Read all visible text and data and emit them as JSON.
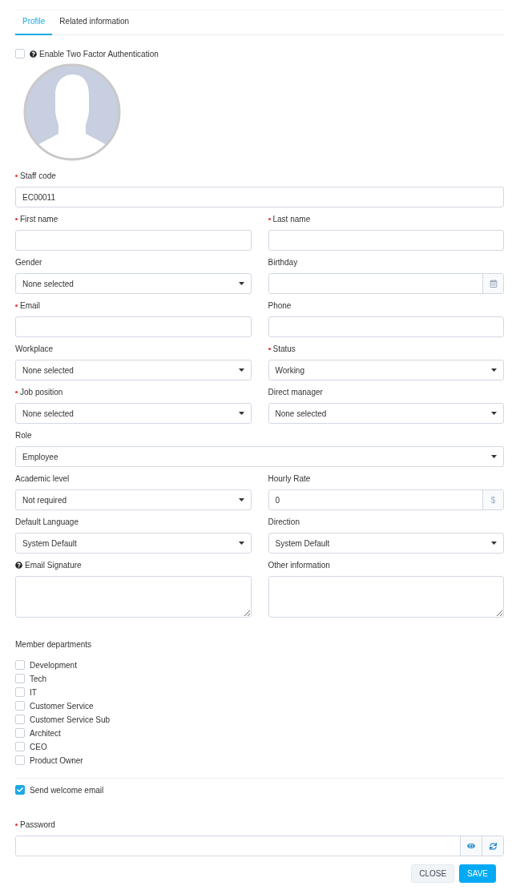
{
  "tabs": [
    {
      "label": "Profile",
      "selected": true
    },
    {
      "label": "Related information",
      "selected": false
    }
  ],
  "two_factor": {
    "label": "Enable Two Factor Authentication",
    "checked": false,
    "help": true
  },
  "avatar": {
    "kind": "picture"
  },
  "rows": [
    [
      {
        "label": "Staff code",
        "required": true,
        "kind": "text",
        "value": "EC00011"
      }
    ],
    [
      {
        "label": "First name",
        "required": true,
        "kind": "text"
      },
      {
        "label": "Last name",
        "required": true,
        "kind": "text"
      }
    ],
    [
      {
        "label": "Gender",
        "required": false,
        "kind": "select",
        "value": "None selected"
      },
      {
        "label": "Birthday",
        "required": false,
        "kind": "date"
      }
    ],
    [
      {
        "label": "Email",
        "required": true,
        "kind": "text"
      },
      {
        "label": "Phone",
        "required": false,
        "kind": "text"
      }
    ],
    [
      {
        "label": "Workplace",
        "required": false,
        "kind": "select",
        "value": "None selected"
      },
      {
        "label": "Status",
        "required": true,
        "kind": "select",
        "value": "Working"
      }
    ],
    [
      {
        "label": "Job position",
        "required": true,
        "kind": "select",
        "value": "None selected"
      },
      {
        "label": "Direct manager",
        "required": false,
        "kind": "select",
        "value": "None selected"
      }
    ],
    [
      {
        "label": "Role",
        "required": false,
        "kind": "select",
        "value": "Employee"
      }
    ],
    [
      {
        "label": "Academic level",
        "required": false,
        "kind": "select",
        "value": "Not required"
      },
      {
        "label": "Hourly Rate",
        "required": false,
        "kind": "addon",
        "value": "0",
        "addon": "$"
      }
    ],
    [
      {
        "label": "Default Language",
        "required": false,
        "kind": "select",
        "value": "System Default"
      },
      {
        "label": "Direction",
        "required": false,
        "kind": "select",
        "value": "System Default"
      }
    ],
    [
      {
        "label": "Email Signature",
        "required": false,
        "kind": "textarea",
        "help": true
      },
      {
        "label": "Other information",
        "required": false,
        "kind": "textarea"
      }
    ]
  ],
  "departments": {
    "title": "Member departments",
    "items": [
      {
        "label": "Development",
        "checked": false
      },
      {
        "label": "Tech",
        "checked": false
      },
      {
        "label": "IT",
        "checked": false
      },
      {
        "label": "Customer Service",
        "checked": false
      },
      {
        "label": "Customer Service Sub",
        "checked": false
      },
      {
        "label": "Architect",
        "checked": false
      },
      {
        "label": "CEO",
        "checked": false
      },
      {
        "label": "Product Owner",
        "checked": false
      }
    ]
  },
  "welcome_email": {
    "label": "Send welcome email",
    "checked": true
  },
  "password": {
    "label": "Password",
    "required": true
  },
  "buttons": [
    {
      "label": "CLOSE",
      "kind": "secondary"
    },
    {
      "label": "SAVE",
      "kind": "primary"
    }
  ]
}
